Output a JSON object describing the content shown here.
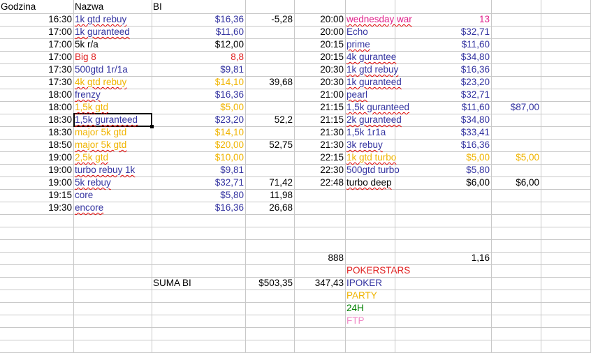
{
  "colors": {
    "black": "#000000",
    "blue": "#3333a0",
    "red": "#e02020",
    "gold": "#f0b400",
    "magenta": "#e0208a",
    "green": "#008000",
    "pink": "#f08cc8",
    "gridline": "#c8c8c8"
  },
  "headers": {
    "a": "Godzina",
    "b": "Nazwa",
    "c": "BI"
  },
  "left_rows": [
    {
      "time": "16:30",
      "name": "1k gtd rebuy",
      "name_color": "blue",
      "spell": true,
      "bi": "$16,36",
      "bi_color": "blue",
      "extra": "-5,28"
    },
    {
      "time": "17:00",
      "name": "1k guranteed",
      "name_color": "blue",
      "spell": true,
      "bi": "$11,60",
      "bi_color": "blue",
      "extra": ""
    },
    {
      "time": "17:00",
      "name": "5k r/a",
      "name_color": "black",
      "spell": false,
      "bi": "$12,00",
      "bi_color": "black",
      "extra": ""
    },
    {
      "time": "17:00",
      "name": "Big 8",
      "name_color": "red",
      "spell": false,
      "bi": "8,8",
      "bi_color": "red",
      "extra": ""
    },
    {
      "time": "17:30",
      "name": "500gtd 1r/1a",
      "name_color": "blue",
      "spell": false,
      "bi": "$9,81",
      "bi_color": "blue",
      "extra": ""
    },
    {
      "time": "17:30",
      "name": "4k gtd rebuy",
      "name_color": "gold",
      "spell": true,
      "bi": "$14,10",
      "bi_color": "gold",
      "extra": "39,68"
    },
    {
      "time": "18:00",
      "name": "frenzy",
      "name_color": "blue",
      "spell": true,
      "bi": "$16,36",
      "bi_color": "blue",
      "extra": ""
    },
    {
      "time": "18:00",
      "name": "1,5k gtd",
      "name_color": "gold",
      "spell": true,
      "bi": "$5,00",
      "bi_color": "gold",
      "extra": ""
    },
    {
      "time": "18:30",
      "name": "1,5k guranteed",
      "name_color": "blue",
      "spell": true,
      "bi": "$23,20",
      "bi_color": "blue",
      "extra": "52,2"
    },
    {
      "time": "18:30",
      "name": "major 5k gtd",
      "name_color": "gold",
      "spell": false,
      "bi": "$14,10",
      "bi_color": "gold",
      "extra": ""
    },
    {
      "time": "18:50",
      "name": "major 5k gtd",
      "name_color": "gold",
      "spell": true,
      "bi": "$20,00",
      "bi_color": "gold",
      "extra": "52,75"
    },
    {
      "time": "19:00",
      "name": "2,5k gtd",
      "name_color": "gold",
      "spell": true,
      "bi": "$10,00",
      "bi_color": "gold",
      "extra": ""
    },
    {
      "time": "19:00",
      "name": "turbo rebuy 1k",
      "name_color": "blue",
      "spell": true,
      "bi": "$9,81",
      "bi_color": "blue",
      "extra": ""
    },
    {
      "time": "19:00",
      "name": "5k rebuy",
      "name_color": "blue",
      "spell": true,
      "bi": "$32,71",
      "bi_color": "blue",
      "extra": "71,42"
    },
    {
      "time": "19:15",
      "name": "core",
      "name_color": "blue",
      "spell": false,
      "bi": "$5,80",
      "bi_color": "blue",
      "extra": "11,98"
    },
    {
      "time": "19:30",
      "name": "encore",
      "name_color": "blue",
      "spell": true,
      "bi": "$16,36",
      "bi_color": "blue",
      "extra": "26,68"
    }
  ],
  "right_rows": [
    {
      "time": "20:00",
      "name": "wednesday war",
      "name_color": "magenta",
      "spell": true,
      "bi": "13",
      "bi_color": "magenta",
      "extra": ""
    },
    {
      "time": "20:00",
      "name": "Echo",
      "name_color": "blue",
      "spell": false,
      "bi": "$32,71",
      "bi_color": "blue",
      "extra": ""
    },
    {
      "time": "20:15",
      "name": "prime",
      "name_color": "blue",
      "spell": true,
      "bi": "$11,60",
      "bi_color": "blue",
      "extra": ""
    },
    {
      "time": "20:15",
      "name": "4k gurantee",
      "name_color": "blue",
      "spell": true,
      "bi": "$34,80",
      "bi_color": "blue",
      "extra": ""
    },
    {
      "time": "20:30",
      "name": "1k gtd rebuy",
      "name_color": "blue",
      "spell": true,
      "bi": "$16,36",
      "bi_color": "blue",
      "extra": ""
    },
    {
      "time": "20:30",
      "name": "1k guranteed",
      "name_color": "blue",
      "spell": true,
      "bi": "$23,20",
      "bi_color": "blue",
      "extra": ""
    },
    {
      "time": "21:00",
      "name": "pearl",
      "name_color": "blue",
      "spell": true,
      "bi": "$32,71",
      "bi_color": "blue",
      "extra": ""
    },
    {
      "time": "21:15",
      "name": "1,5k guranteed",
      "name_color": "blue",
      "spell": true,
      "bi": "$11,60",
      "bi_color": "blue",
      "extra": "$87,00"
    },
    {
      "time": "21:15",
      "name": "2k guranteed",
      "name_color": "blue",
      "spell": true,
      "bi": "$34,80",
      "bi_color": "blue",
      "extra": ""
    },
    {
      "time": "21:30",
      "name": "1,5k 1r1a",
      "name_color": "blue",
      "spell": false,
      "bi": "$33,41",
      "bi_color": "blue",
      "extra": ""
    },
    {
      "time": "21:30",
      "name": "3k rebuy",
      "name_color": "blue",
      "spell": true,
      "bi": "$16,36",
      "bi_color": "blue",
      "extra": ""
    },
    {
      "time": "22:15",
      "name": "1k gtd turbo",
      "name_color": "gold",
      "spell": true,
      "bi": "$5,00",
      "bi_color": "gold",
      "extra": "$5,00"
    },
    {
      "time": "22:30",
      "name": "500gtd turbo",
      "name_color": "blue",
      "spell": false,
      "bi": "$5,80",
      "bi_color": "blue",
      "extra": ""
    },
    {
      "time": "22:48",
      "name": "turbo deep",
      "name_color": "black",
      "spell": true,
      "bi": "$6,00",
      "bi_color": "black",
      "extra": "$6,00"
    }
  ],
  "summary": {
    "label": "SUMA BI",
    "total": "$503,35",
    "extra_total": "347,43",
    "site_888_label": "888",
    "site_888_value": "1,16"
  },
  "legend": [
    {
      "label": "POKERSTARS",
      "color": "red"
    },
    {
      "label": "IPOKER",
      "color": "blue"
    },
    {
      "label": "PARTY",
      "color": "gold"
    },
    {
      "label": "24H",
      "color": "green"
    },
    {
      "label": "FTP",
      "color": "pink"
    }
  ],
  "selected_cell": {
    "name": "1,5k guranteed",
    "row": "18:30"
  }
}
